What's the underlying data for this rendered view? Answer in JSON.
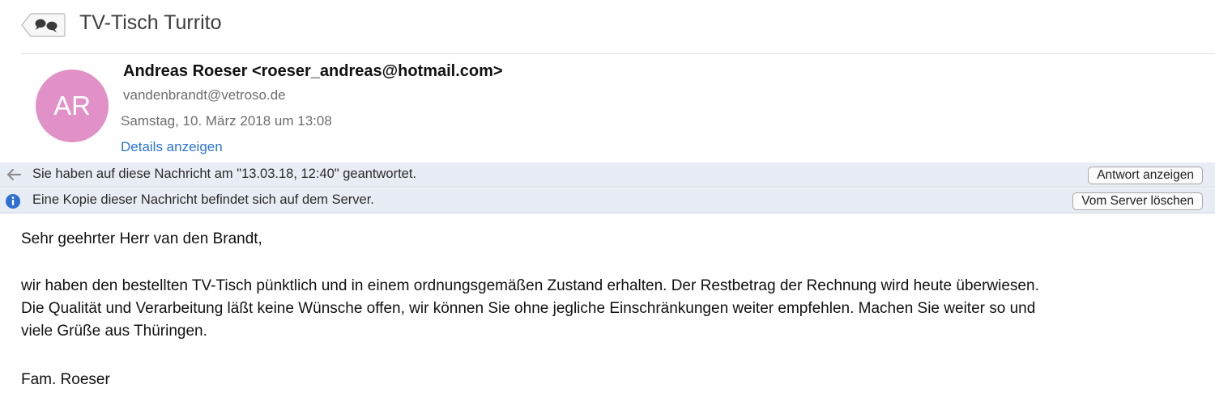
{
  "subject": {
    "thread_icon": "conversation-bubbles-icon",
    "title": "TV-Tisch Turrito"
  },
  "header": {
    "avatar_initials": "AR",
    "avatar_color": "#e190c8",
    "from": "Andreas Roeser <roeser_andreas@hotmail.com>",
    "to": "vandenbrandt@vetroso.de",
    "date": "Samstag, 10. März 2018 um 13:08",
    "details_link": "Details anzeigen"
  },
  "banners": [
    {
      "icon": "reply-arrow-icon",
      "text": "Sie haben auf diese Nachricht am \"13.03.18, 12:40\" geantwortet.",
      "button": "Antwort anzeigen"
    },
    {
      "icon": "info-icon",
      "text": "Eine Kopie dieser Nachricht befindet sich auf dem Server.",
      "button": "Vom Server löschen"
    }
  ],
  "body": {
    "greeting": "Sehr geehrter Herr van den Brandt,",
    "paragraph_line_1": "wir haben den bestellten TV-Tisch pünktlich und in einem ordnungsgemäßen Zustand erhalten. Der Restbetrag der Rechnung wird heute überwiesen.",
    "paragraph_line_2": "Die Qualität und Verarbeitung läßt keine Wünsche offen, wir können Sie ohne jegliche Einschränkungen weiter empfehlen. Machen Sie weiter so und",
    "paragraph_line_3": "viele Grüße aus Thüringen.",
    "signature": "Fam. Roeser"
  },
  "colors": {
    "link": "#2a73d6",
    "banner_background": "#e8ecf4",
    "info_icon": "#2f6fd1"
  }
}
